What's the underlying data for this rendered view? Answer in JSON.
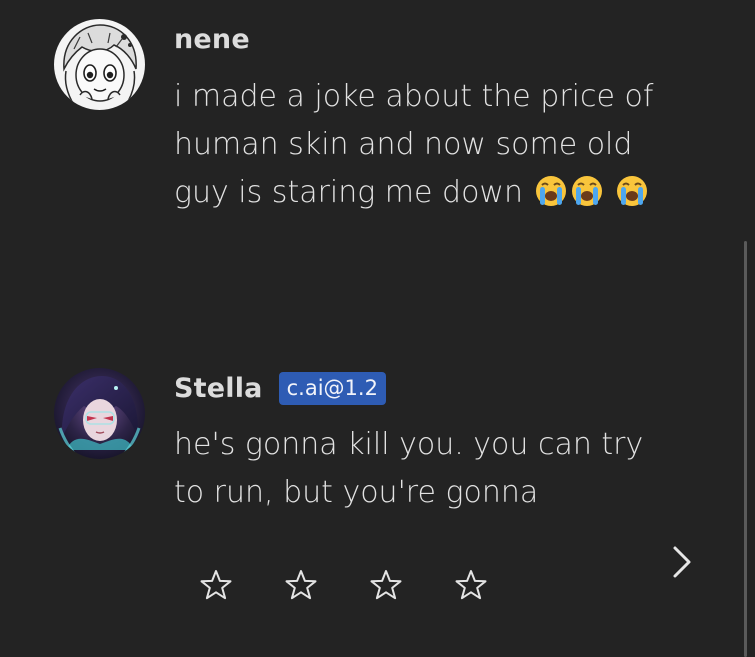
{
  "messages": [
    {
      "author": "nene",
      "avatar_icon": "manga-girl-avatar",
      "text": "i made a joke about the price of human skin and now some old guy is staring me down",
      "emojis": [
        "loudly-crying-face",
        "loudly-crying-face",
        "loudly-crying-face"
      ]
    },
    {
      "author": "Stella",
      "badge": "c.ai@1.2",
      "avatar_icon": "fantasy-character-avatar",
      "text": "he's gonna kill you. you can try to run, but you're gonna"
    }
  ],
  "controls": {
    "next_icon": "chevron-right-icon",
    "rating": {
      "stars": [
        "☆",
        "☆",
        "☆",
        "☆"
      ],
      "selected": 0,
      "max": 4
    }
  },
  "colors": {
    "background": "#232323",
    "text": "#e2e2e2",
    "badge": "#2e5cb4",
    "emoji_face": "#f9c53c",
    "tears": "#4ea7ee"
  }
}
